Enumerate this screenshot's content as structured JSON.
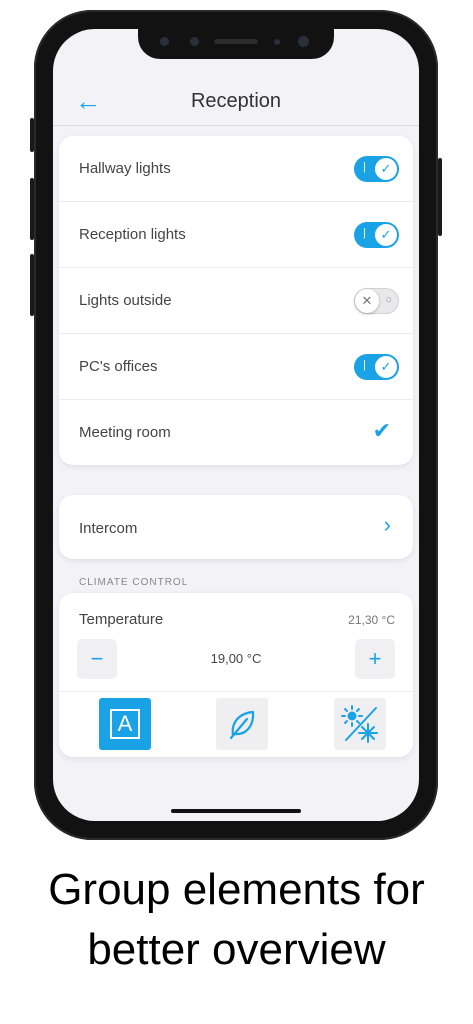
{
  "header": {
    "back_icon": "back-arrow-icon",
    "title": "Reception"
  },
  "lights": [
    {
      "label": "Hallway lights",
      "control": "toggle",
      "on": true
    },
    {
      "label": "Reception lights",
      "control": "toggle",
      "on": true
    },
    {
      "label": "Lights outside",
      "control": "toggle",
      "on": false
    },
    {
      "label": "PC's offices",
      "control": "toggle",
      "on": true
    },
    {
      "label": "Meeting room",
      "control": "check",
      "on": true
    }
  ],
  "intercom": {
    "label": "Intercom"
  },
  "climate": {
    "section_title": "CLIMATE CONTROL",
    "temperature_label": "Temperature",
    "current_temperature": "21,30 °C",
    "setpoint": "19,00 °C",
    "decrease_symbol": "−",
    "increase_symbol": "+",
    "modes": [
      {
        "name": "auto",
        "symbol": "A",
        "active": true
      },
      {
        "name": "eco",
        "icon": "leaf-icon",
        "active": false
      },
      {
        "name": "heat-cool",
        "icon": "sun-snowflake-icon",
        "active": false
      }
    ]
  },
  "colors": {
    "accent": "#1aa2e6",
    "background": "#f2f2f7"
  },
  "caption": {
    "line1": "Group elements for",
    "line2": "better overview"
  }
}
